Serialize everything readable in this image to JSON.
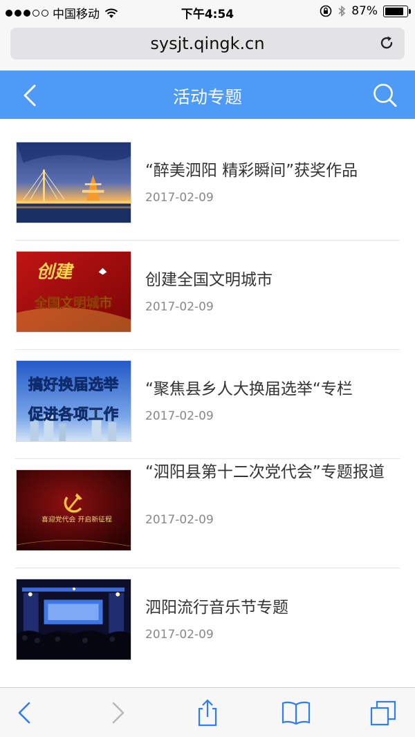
{
  "status_bar": {
    "carrier": "中国移动",
    "time": "下午4:54",
    "battery": "87%",
    "battery_level": 0.87,
    "signal_bars": 3
  },
  "browser": {
    "url": "sysjt.qingk.cn"
  },
  "header": {
    "title": "活动专题"
  },
  "items": [
    {
      "title": "“醉美泗阳 精彩瞬间”获奖作品",
      "date": "2017-02-09"
    },
    {
      "title": "创建全国文明城市",
      "date": "2017-02-09",
      "thumb_text": [
        "创建",
        "全国文明城市"
      ]
    },
    {
      "title": "“聚焦县乡人大换届选举“专栏",
      "date": "2017-02-09",
      "thumb_text": [
        "搞好换届选举",
        "促进各项工作"
      ]
    },
    {
      "title": "“泗阳县第十二次党代会”专题报道",
      "date": "2017-02-09",
      "thumb_text": [
        "喜迎党代会 开启新征程"
      ]
    },
    {
      "title": "泗阳流行音乐节专题",
      "date": "2017-02-09"
    }
  ],
  "colors": {
    "header": "#4d9af7",
    "toolbar_icon": "#2f7cf6",
    "disabled_icon": "#b8b8bd"
  }
}
